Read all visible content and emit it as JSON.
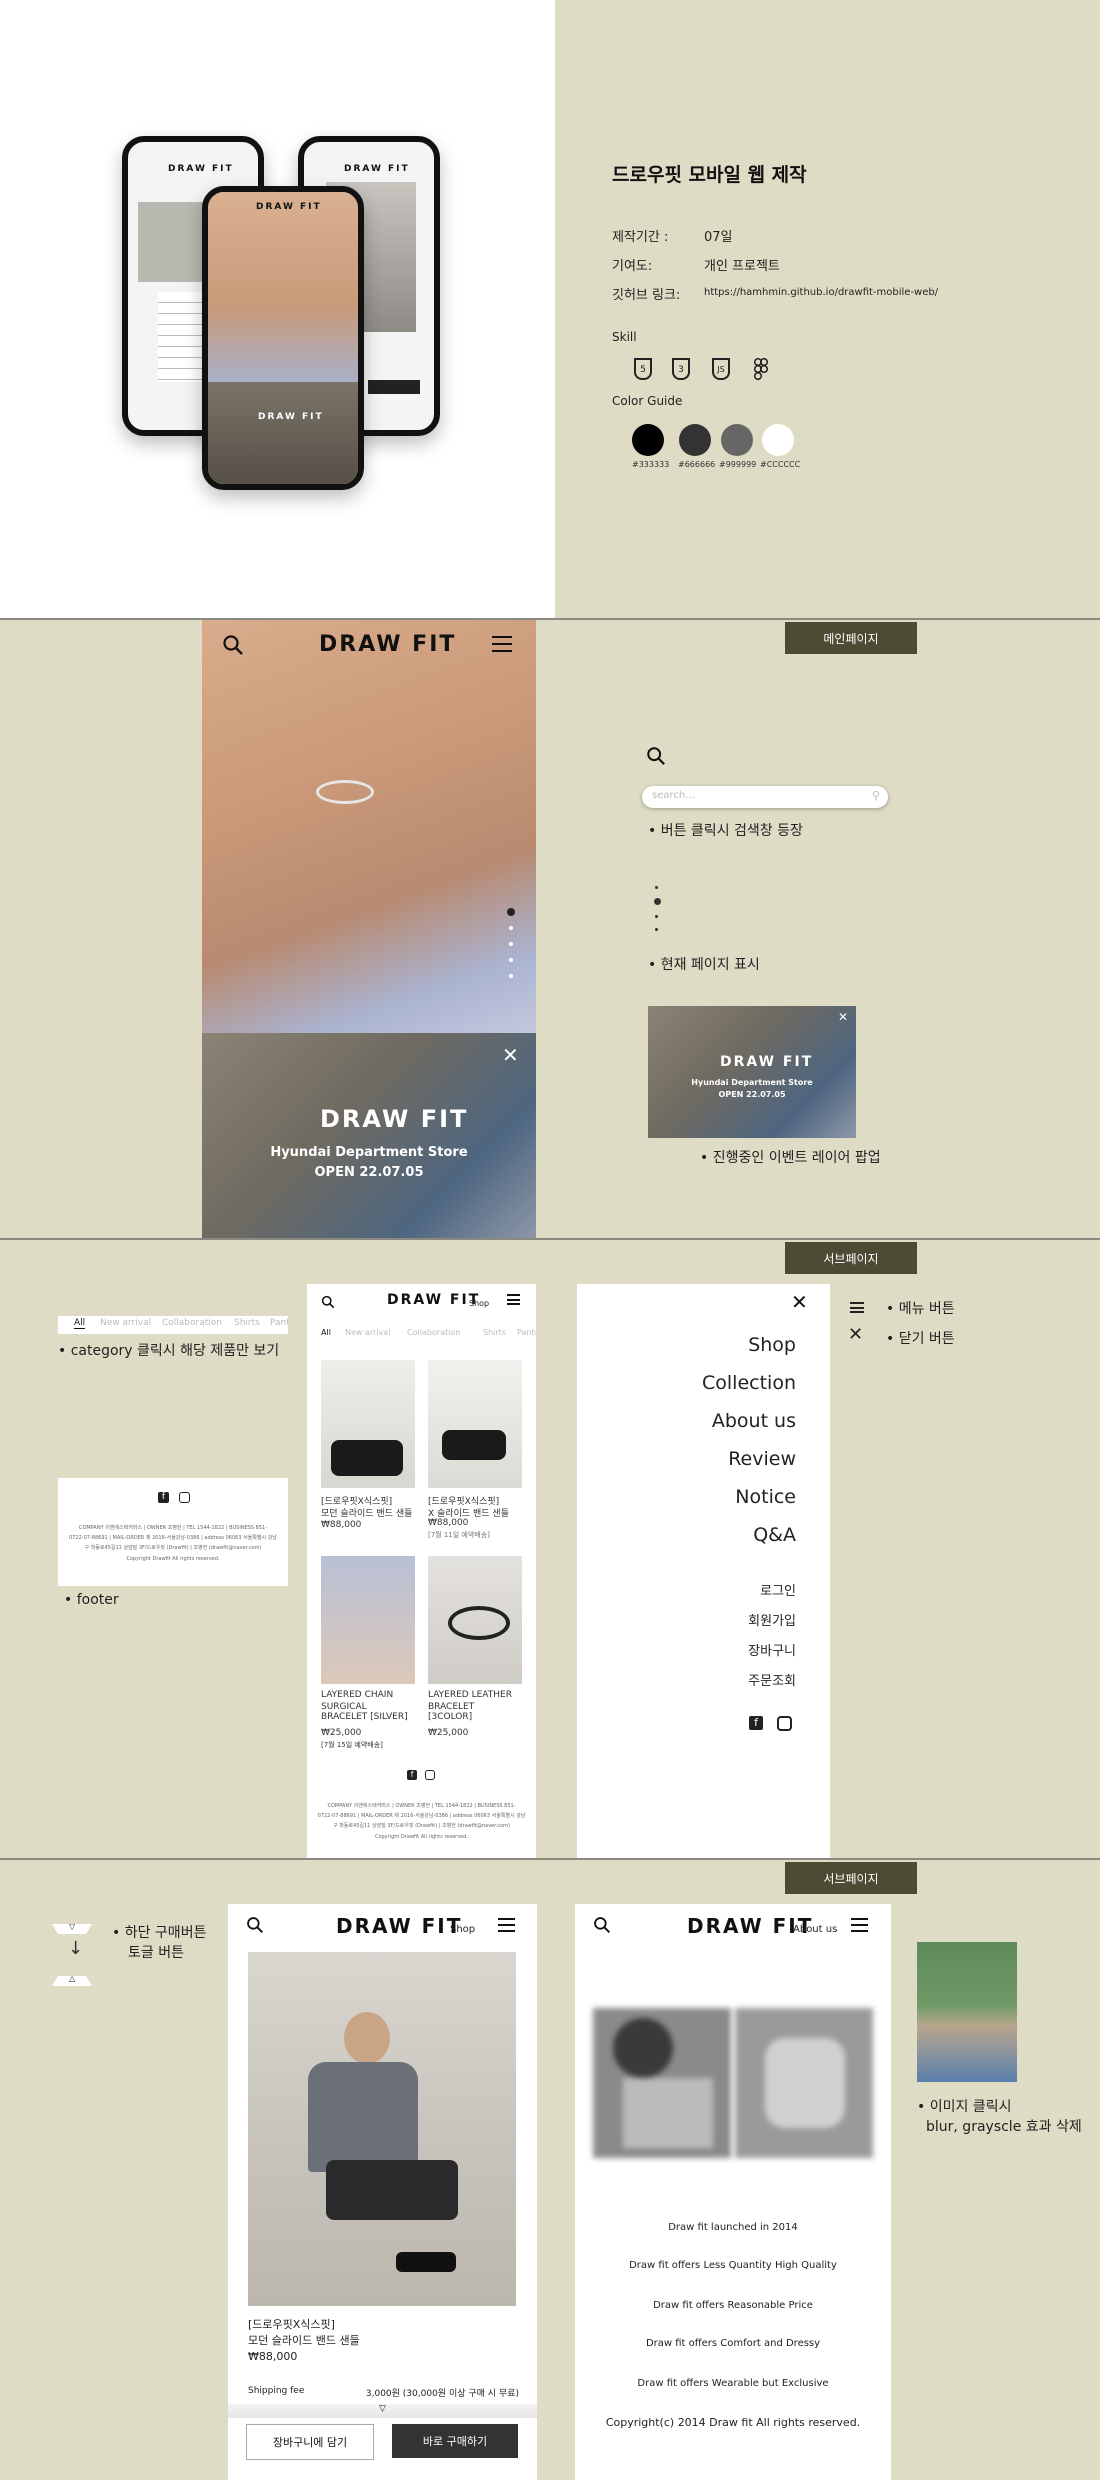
{
  "intro": {
    "title": "드로우핏 모바일 웹 제작",
    "period_label": "제작기간 :",
    "period_value": "07일",
    "contribution_label": "기여도:",
    "contribution_value": "개인 프로젝트",
    "github_label": "깃허브 링크:",
    "github_value": "https://hamhmin.github.io/drawfit-mobile-web/",
    "skill_label": "Skill",
    "skills": [
      "html5-icon",
      "css3-icon",
      "javascript-icon",
      "figma-icon"
    ],
    "color_label": "Color Guide",
    "colors": [
      {
        "hex": "#000000",
        "label": "#333333"
      },
      {
        "hex": "#333333",
        "label": "#666666"
      },
      {
        "hex": "#666666",
        "label": "#999999"
      },
      {
        "hex": "#ffffff",
        "label": "#CCCCCC"
      }
    ]
  },
  "brand": {
    "logo": "DRAW FIT"
  },
  "section_main": {
    "tag": "메인페이지",
    "search_placeholder": "search...",
    "note_search": "버튼 클릭시 검색창 등장",
    "note_page": "현재 페이지 표시",
    "note_popup": "진행중인 이벤트 레이어 팝업",
    "popup_store": "Hyundai Department Store",
    "popup_open": "OPEN 22.07.05"
  },
  "section_sub1": {
    "tag": "서브페이지",
    "categories": [
      "All",
      "New arrival",
      "Collaboration",
      "Shirts",
      "Pants"
    ],
    "note_category": "category 클릭시 해당 제품만 보기",
    "note_footer": "footer",
    "footer_lines": [
      "COMPANY 이앤에스텍커머스 | OWNER 조병헌 | TEL 1544-1822 | BUSINESS 851-",
      "0722-07-88691 | MAIL-ORDER 제 2016-서울강남-0386 | address 06063 서울특별시 강남",
      "구 학동로45길11 상암빌 3F/드로우핏 (Drawfit) | 조병헌 (drawfit@naver.com)",
      "Copyright Drawfit All rights reserved."
    ],
    "shop_label": "Shop",
    "products": [
      {
        "name1": "[드로우핏X식스핏]",
        "name2": "모던 슬라이드 밴드 샌들",
        "price": "₩88,000",
        "note": ""
      },
      {
        "name1": "[드로우핏X식스핏]",
        "name2": "X 슬라이드 밴드 샌들",
        "price": "₩88,000",
        "note": "[7월 11일 예약배송]"
      },
      {
        "name1": "LAYERED CHAIN",
        "name2": "SURGICAL BRACELET [SILVER]",
        "price": "₩25,000",
        "note": "[7월 15일 예약배송]"
      },
      {
        "name1": "LAYERED LEATHER",
        "name2": "BRACELET [3COLOR]",
        "price": "₩25,000",
        "note": ""
      }
    ],
    "menu_primary": [
      "Shop",
      "Collection",
      "About us",
      "Review",
      "Notice",
      "Q&A"
    ],
    "menu_secondary": [
      "로그인",
      "회원가입",
      "장바구니",
      "주문조회"
    ],
    "note_menu": "메뉴 버튼",
    "note_close": "닫기 버튼"
  },
  "section_sub2": {
    "tag": "서브페이지",
    "note_toggle_1": "하단 구매버튼",
    "note_toggle_2": "토글 버튼",
    "shop_label": "Shop",
    "product_name1": "[드로우핏X식스핏]",
    "product_name2": "모던 슬라이드 밴드 샌들",
    "product_price": "₩88,000",
    "shipping_label": "Shipping fee",
    "shipping_value": "3,000원 (30,000원 이상 구매 시 무료)",
    "btn_cart": "장바구니에 담기",
    "btn_buy": "바로 구매하기",
    "about_label": "About us",
    "about_lines": [
      "Draw fit launched in 2014",
      "Draw fit offers Less Quantity High Quality",
      "Draw fit offers Reasonable Price",
      "Draw fit offers Comfort and Dressy",
      "Draw fit offers Wearable but Exclusive",
      "Copyright(c) 2014 Draw fit All rights reserved."
    ],
    "note_image_1": "이미지 클릭시",
    "note_image_2": "blur, grayscle 효과 삭제"
  }
}
